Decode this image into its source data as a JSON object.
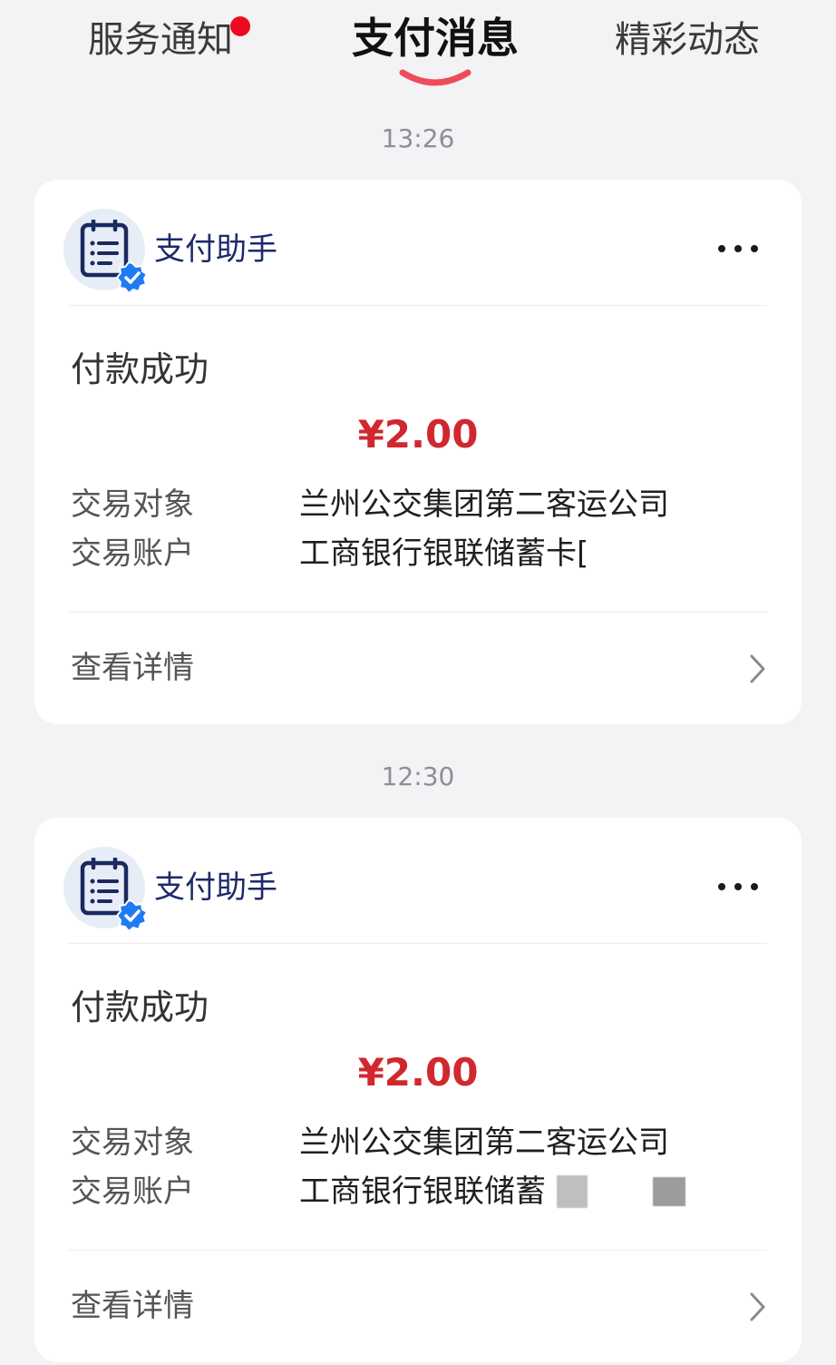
{
  "tabs": [
    {
      "label": "服务通知",
      "has_badge": true,
      "active": false
    },
    {
      "label": "支付消息",
      "active": true
    },
    {
      "label": "精彩动态",
      "active": false
    }
  ],
  "colors": {
    "accent_underline": "#ef4b5b",
    "amount_red": "#d0282e",
    "badge_red": "#ee0a1e",
    "verified_blue": "#1f7bf2"
  },
  "messages": [
    {
      "time": "13:26",
      "sender": "支付助手",
      "sender_icon": "clipboard-list-icon",
      "status": "付款成功",
      "amount": "¥2.00",
      "counterparty_label": "交易对象",
      "counterparty": "兰州公交集团第二客运公司",
      "account_label": "交易账户",
      "account": "工商银行银联储蓄卡[",
      "detail_label": "查看详情"
    },
    {
      "time": "12:30",
      "sender": "支付助手",
      "sender_icon": "clipboard-list-icon",
      "status": "付款成功",
      "amount": "¥2.00",
      "counterparty_label": "交易对象",
      "counterparty": "兰州公交集团第二客运公司",
      "account_label": "交易账户",
      "account": "工商银行银联储蓄",
      "detail_label": "查看详情"
    }
  ]
}
